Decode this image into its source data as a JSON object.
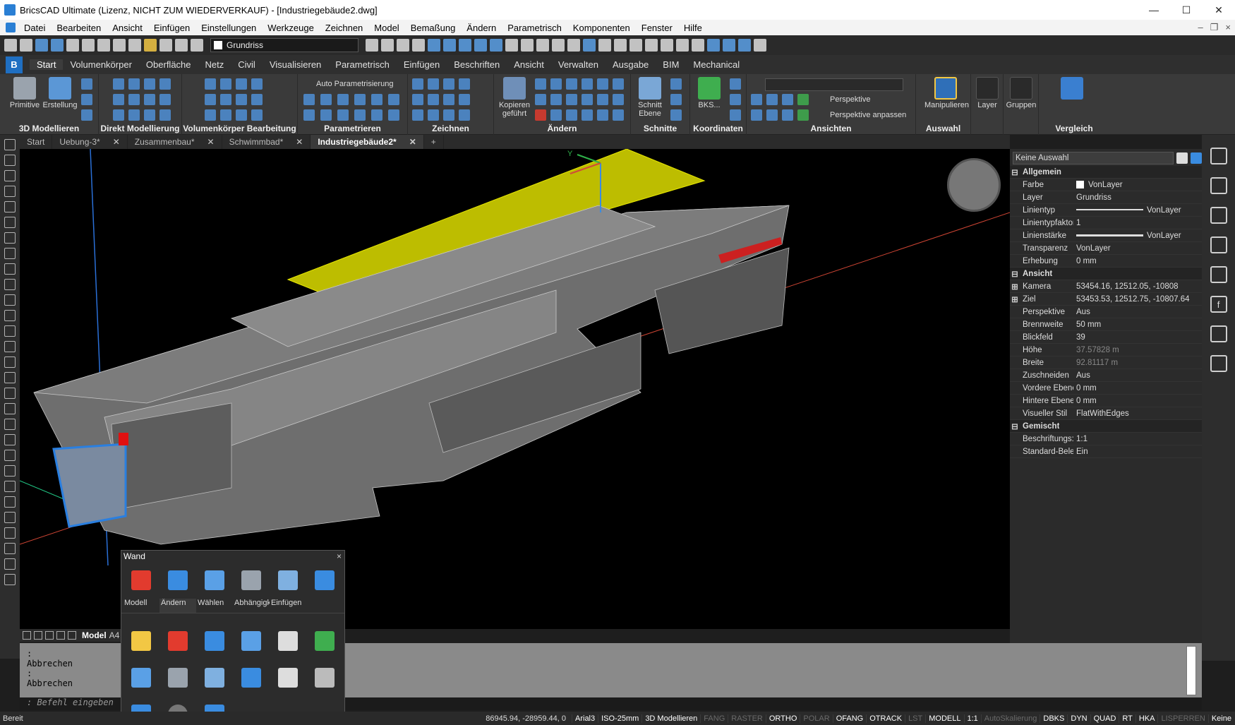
{
  "window": {
    "title": "BricsCAD Ultimate (Lizenz, NICHT ZUM WIEDERVERKAUF) - [Industriegebäude2.dwg]",
    "minimize": "—",
    "maximize": "☐",
    "close": "✕"
  },
  "menu": [
    "Datei",
    "Bearbeiten",
    "Ansicht",
    "Einfügen",
    "Einstellungen",
    "Werkzeuge",
    "Zeichnen",
    "Model",
    "Bemaßung",
    "Ändern",
    "Parametrisch",
    "Komponenten",
    "Fenster",
    "Hilfe"
  ],
  "qat": {
    "layer": "Grundriss"
  },
  "ribbon_tabs": [
    "Start",
    "Volumenkörper",
    "Oberfläche",
    "Netz",
    "Civil",
    "Visualisieren",
    "Parametrisch",
    "Einfügen",
    "Beschriften",
    "Ansicht",
    "Verwalten",
    "Ausgabe",
    "BIM",
    "Mechanical"
  ],
  "ribbon_active": "Start",
  "ribbon": {
    "primitive": "Primitive",
    "erstellung": "Erstellung",
    "auto_param": "Auto Parametrisierung",
    "kopieren": "Kopieren gefuhrt",
    "kopieren_line1": "Kopieren",
    "kopieren_line2": "geführt",
    "schnitt1": "Schnitt",
    "schnitt2": "Ebene",
    "bks": "BKS...",
    "perspektive": "Perspektive",
    "perspektive_anpassen": "Perspektive anpassen",
    "manipulieren": "Manipulieren",
    "layer": "Layer",
    "gruppen": "Gruppen",
    "groups": [
      "3D Modellieren",
      "Direkt Modellierung",
      "Volumenkörper Bearbeitung",
      "Parametrieren",
      "Zeichnen",
      "Ändern",
      "Schnitte",
      "Koordinaten",
      "Ansichten",
      "Auswahl",
      "Vergleich"
    ]
  },
  "doc_tabs": [
    {
      "label": "Start"
    },
    {
      "label": "Uebung-3*"
    },
    {
      "label": "Zusammenbau*"
    },
    {
      "label": "Schwimmbad*"
    },
    {
      "label": "Industriegebäude2*"
    }
  ],
  "properties": {
    "selection": "Keine Auswahl",
    "cat_allgemein": "Allgemein",
    "cat_ansicht": "Ansicht",
    "cat_gemischt": "Gemischt",
    "rows": [
      {
        "k": "Farbe",
        "v": "VonLayer"
      },
      {
        "k": "Layer",
        "v": "Grundriss"
      },
      {
        "k": "Linientyp",
        "v": "VonLayer"
      },
      {
        "k": "Linientypfaktor",
        "v": "1"
      },
      {
        "k": "Linienstärke",
        "v": "VonLayer"
      },
      {
        "k": "Transparenz",
        "v": "VonLayer"
      },
      {
        "k": "Erhebung",
        "v": "0 mm"
      }
    ],
    "view_rows": [
      {
        "k": "Kamera",
        "v": "53454.16, 12512.05, -10808"
      },
      {
        "k": "Ziel",
        "v": "53453.53, 12512.75, -10807.64"
      },
      {
        "k": "Perspektive",
        "v": "Aus"
      },
      {
        "k": "Brennweite",
        "v": "50 mm"
      },
      {
        "k": "Blickfeld",
        "v": "39"
      },
      {
        "k": "Höhe",
        "v": "37.57828 m"
      },
      {
        "k": "Breite",
        "v": "92.81117 m"
      },
      {
        "k": "Zuschneiden",
        "v": "Aus"
      },
      {
        "k": "Vordere Ebene",
        "v": "0 mm"
      },
      {
        "k": "Hintere Ebene",
        "v": "0 mm"
      },
      {
        "k": "Visueller Stil",
        "v": "FlatWithEdges"
      }
    ],
    "mixed_rows": [
      {
        "k": "Beschriftungs:",
        "v": "1:1"
      },
      {
        "k": "Standard-Bele:",
        "v": "Ein"
      }
    ]
  },
  "quad": {
    "title": "Wand",
    "close": "×",
    "labels": [
      "Modell",
      "Ändern",
      "Wählen",
      "Abhängigkei",
      "Einfügen"
    ]
  },
  "layout_tabs": {
    "model": "Model",
    "a4": "A4"
  },
  "command": {
    "lines": [
      "Abbrechen",
      ":",
      "Abbrechen",
      ":",
      "Abbrechen"
    ],
    "prompt": ": Befehl eingeben"
  },
  "status": {
    "ready": "Bereit",
    "coords": "86945.94, -28959.44, 0",
    "items": [
      {
        "t": "Arial3",
        "on": true
      },
      {
        "t": "ISO-25mm",
        "on": true
      },
      {
        "t": "3D Modellieren",
        "on": true
      },
      {
        "t": "FANG",
        "on": false
      },
      {
        "t": "RASTER",
        "on": false
      },
      {
        "t": "ORTHO",
        "on": true
      },
      {
        "t": "POLAR",
        "on": false
      },
      {
        "t": "OFANG",
        "on": true
      },
      {
        "t": "OTRACK",
        "on": true
      },
      {
        "t": "LST",
        "on": false
      },
      {
        "t": "MODELL",
        "on": true
      },
      {
        "t": "1:1",
        "on": true
      },
      {
        "t": "AutoSkalierung",
        "on": false
      },
      {
        "t": "DBKS",
        "on": true
      },
      {
        "t": "DYN",
        "on": true
      },
      {
        "t": "QUAD",
        "on": true
      },
      {
        "t": "RT",
        "on": true
      },
      {
        "t": "HKA",
        "on": true
      },
      {
        "t": "LISPERREN",
        "on": false
      },
      {
        "t": "Keine",
        "on": true
      }
    ]
  },
  "colors": {
    "accent": "#1f6fc2",
    "selection": "#c8c000",
    "viewport": "#000000"
  }
}
